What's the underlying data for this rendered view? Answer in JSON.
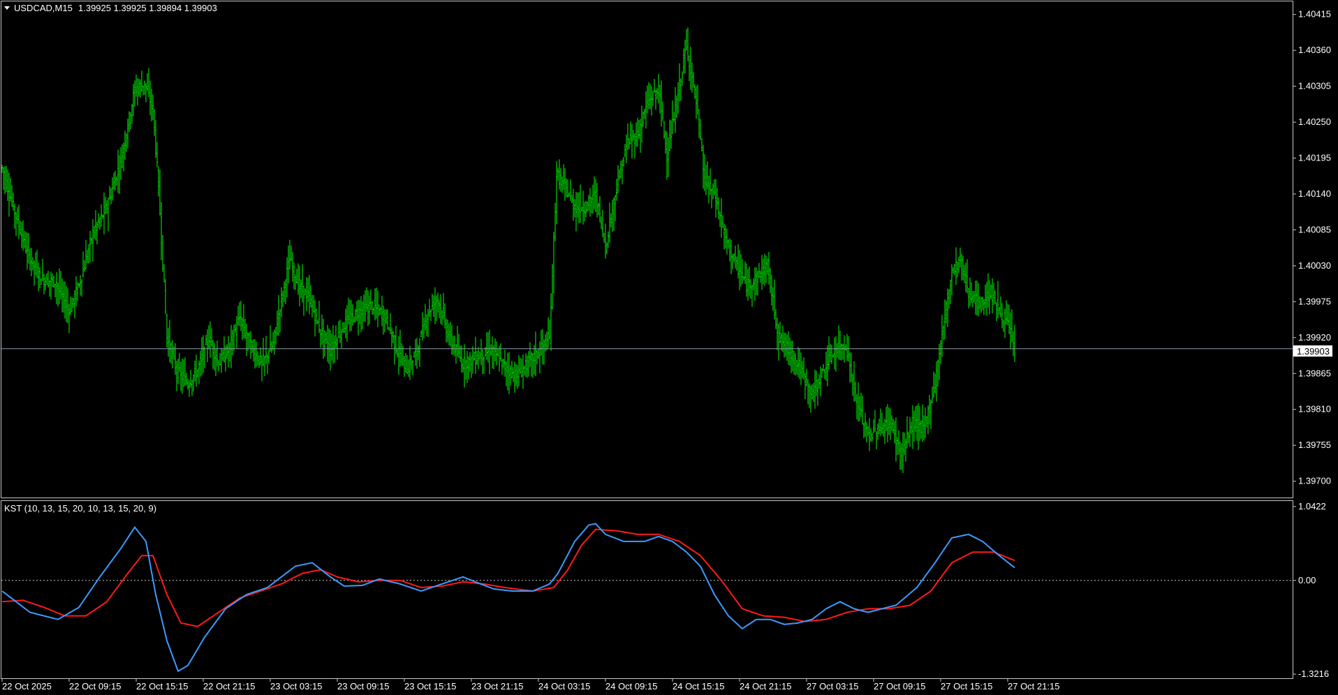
{
  "main_header": {
    "symbol": "USDCAD,M15",
    "ohlc": "1.39925 1.39925 1.39894 1.39903"
  },
  "indicator_header": "KST (10, 13, 15, 20, 10, 13, 15, 20, 9)",
  "current_price_label": "1.39903",
  "colors": {
    "background": "#000000",
    "bars": "#00ff00",
    "frame": "#c8c8c8",
    "price_line": "#8a9aa8",
    "kst_line": "#3a9bff",
    "signal_line": "#ff1a1a",
    "zero_line": "#c8c8c8",
    "text": "#ffffff"
  },
  "price_axis": {
    "ticks": [
      "1.40415",
      "1.40360",
      "1.40305",
      "1.40250",
      "1.40195",
      "1.40140",
      "1.40085",
      "1.40030",
      "1.39975",
      "1.39920",
      "1.39865",
      "1.39810",
      "1.39755",
      "1.39700"
    ],
    "min": 1.39675,
    "max": 1.40435
  },
  "indicator_axis": {
    "ticks": [
      "1.0422",
      "0.00",
      "-1.3216"
    ],
    "min": -1.38,
    "max": 1.12
  },
  "time_axis": {
    "labels": [
      "22 Oct 2025",
      "22 Oct 09:15",
      "22 Oct 15:15",
      "22 Oct 21:15",
      "23 Oct 03:15",
      "23 Oct 09:15",
      "23 Oct 15:15",
      "23 Oct 21:15",
      "24 Oct 03:15",
      "24 Oct 09:15",
      "24 Oct 15:15",
      "24 Oct 21:15",
      "27 Oct 03:15",
      "27 Oct 09:15",
      "27 Oct 15:15",
      "27 Oct 21:15"
    ]
  },
  "chart_data": {
    "type": "line",
    "description_units": "price path for OHLC bars (USDCAD M15) and KST indicator values",
    "price_path": [
      [
        0,
        1.4018
      ],
      [
        8,
        1.4012
      ],
      [
        18,
        1.4005
      ],
      [
        28,
        1.4001
      ],
      [
        38,
        1.40005
      ],
      [
        48,
        1.3996
      ],
      [
        55,
        1.4
      ],
      [
        65,
        1.4008
      ],
      [
        75,
        1.4012
      ],
      [
        85,
        1.4019
      ],
      [
        95,
        1.403
      ],
      [
        102,
        1.4031
      ],
      [
        108,
        1.4027
      ],
      [
        112,
        1.4015
      ],
      [
        118,
        1.3992
      ],
      [
        125,
        1.3987
      ],
      [
        133,
        1.3985
      ],
      [
        140,
        1.3987
      ],
      [
        148,
        1.3992
      ],
      [
        155,
        1.3988
      ],
      [
        162,
        1.399
      ],
      [
        170,
        1.3995
      ],
      [
        178,
        1.39905
      ],
      [
        186,
        1.3988
      ],
      [
        194,
        1.3991
      ],
      [
        200,
        1.3998
      ],
      [
        206,
        1.4004
      ],
      [
        212,
        1.4
      ],
      [
        220,
        1.3998
      ],
      [
        228,
        1.3993
      ],
      [
        235,
        1.399
      ],
      [
        245,
        1.3994
      ],
      [
        255,
        1.3996
      ],
      [
        265,
        1.3997
      ],
      [
        275,
        1.3995
      ],
      [
        283,
        1.399
      ],
      [
        290,
        1.3987
      ],
      [
        297,
        1.399
      ],
      [
        305,
        1.3996
      ],
      [
        312,
        1.3998
      ],
      [
        320,
        1.3992
      ],
      [
        330,
        1.3988
      ],
      [
        340,
        1.3989
      ],
      [
        350,
        1.399
      ],
      [
        360,
        1.39875
      ],
      [
        368,
        1.3986
      ],
      [
        376,
        1.3988
      ],
      [
        385,
        1.399
      ],
      [
        392,
        1.3992
      ],
      [
        397,
        1.4017
      ],
      [
        403,
        1.4015
      ],
      [
        410,
        1.4012
      ],
      [
        418,
        1.4012
      ],
      [
        425,
        1.4014
      ],
      [
        432,
        1.4006
      ],
      [
        440,
        1.4015
      ],
      [
        448,
        1.4022
      ],
      [
        455,
        1.4023
      ],
      [
        462,
        1.4028
      ],
      [
        470,
        1.403
      ],
      [
        476,
        1.402
      ],
      [
        483,
        1.4028
      ],
      [
        490,
        1.4037
      ],
      [
        497,
        1.4028
      ],
      [
        503,
        1.4016
      ],
      [
        510,
        1.4014
      ],
      [
        518,
        1.4007
      ],
      [
        526,
        1.4003
      ],
      [
        533,
        1.4
      ],
      [
        540,
        1.4001
      ],
      [
        548,
        1.4003
      ],
      [
        556,
        1.3992
      ],
      [
        564,
        1.399
      ],
      [
        572,
        1.3987
      ],
      [
        580,
        1.3983
      ],
      [
        588,
        1.3987
      ],
      [
        596,
        1.399
      ],
      [
        604,
        1.3991
      ],
      [
        612,
        1.3982
      ],
      [
        620,
        1.3977
      ],
      [
        628,
        1.3978
      ],
      [
        636,
        1.3979
      ],
      [
        644,
        1.3974
      ],
      [
        652,
        1.3979
      ],
      [
        660,
        1.3978
      ],
      [
        668,
        1.3985
      ],
      [
        674,
        1.3994
      ],
      [
        680,
        1.4002
      ],
      [
        686,
        1.4004
      ],
      [
        692,
        1.3999
      ],
      [
        700,
        1.3997
      ],
      [
        708,
        1.3999
      ],
      [
        714,
        1.3996
      ],
      [
        720,
        1.3994
      ],
      [
        725,
        1.39903
      ]
    ],
    "kst_path": [
      [
        0,
        -0.15
      ],
      [
        20,
        -0.45
      ],
      [
        40,
        -0.55
      ],
      [
        55,
        -0.38
      ],
      [
        70,
        0.05
      ],
      [
        85,
        0.45
      ],
      [
        95,
        0.75
      ],
      [
        103,
        0.55
      ],
      [
        110,
        -0.2
      ],
      [
        118,
        -0.85
      ],
      [
        126,
        -1.28
      ],
      [
        133,
        -1.2
      ],
      [
        145,
        -0.8
      ],
      [
        160,
        -0.4
      ],
      [
        175,
        -0.2
      ],
      [
        190,
        -0.1
      ],
      [
        200,
        0.05
      ],
      [
        210,
        0.2
      ],
      [
        222,
        0.25
      ],
      [
        235,
        0.05
      ],
      [
        245,
        -0.08
      ],
      [
        258,
        -0.07
      ],
      [
        270,
        0.02
      ],
      [
        285,
        -0.05
      ],
      [
        300,
        -0.15
      ],
      [
        315,
        -0.05
      ],
      [
        330,
        0.05
      ],
      [
        340,
        -0.03
      ],
      [
        352,
        -0.12
      ],
      [
        365,
        -0.15
      ],
      [
        380,
        -0.15
      ],
      [
        392,
        -0.05
      ],
      [
        398,
        0.1
      ],
      [
        410,
        0.55
      ],
      [
        420,
        0.78
      ],
      [
        425,
        0.8
      ],
      [
        432,
        0.65
      ],
      [
        445,
        0.55
      ],
      [
        460,
        0.55
      ],
      [
        470,
        0.62
      ],
      [
        480,
        0.55
      ],
      [
        490,
        0.4
      ],
      [
        500,
        0.2
      ],
      [
        510,
        -0.2
      ],
      [
        520,
        -0.5
      ],
      [
        530,
        -0.68
      ],
      [
        540,
        -0.55
      ],
      [
        550,
        -0.55
      ],
      [
        560,
        -0.62
      ],
      [
        570,
        -0.6
      ],
      [
        580,
        -0.55
      ],
      [
        590,
        -0.4
      ],
      [
        600,
        -0.3
      ],
      [
        610,
        -0.4
      ],
      [
        620,
        -0.45
      ],
      [
        630,
        -0.4
      ],
      [
        640,
        -0.35
      ],
      [
        655,
        -0.1
      ],
      [
        668,
        0.25
      ],
      [
        680,
        0.6
      ],
      [
        692,
        0.65
      ],
      [
        702,
        0.55
      ],
      [
        714,
        0.35
      ],
      [
        725,
        0.18
      ]
    ],
    "signal_path": [
      [
        0,
        -0.3
      ],
      [
        15,
        -0.28
      ],
      [
        30,
        -0.38
      ],
      [
        45,
        -0.5
      ],
      [
        60,
        -0.5
      ],
      [
        75,
        -0.3
      ],
      [
        90,
        0.1
      ],
      [
        100,
        0.35
      ],
      [
        108,
        0.35
      ],
      [
        118,
        -0.2
      ],
      [
        128,
        -0.6
      ],
      [
        140,
        -0.65
      ],
      [
        155,
        -0.45
      ],
      [
        170,
        -0.25
      ],
      [
        185,
        -0.15
      ],
      [
        200,
        -0.05
      ],
      [
        215,
        0.1
      ],
      [
        228,
        0.15
      ],
      [
        240,
        0.05
      ],
      [
        255,
        -0.02
      ],
      [
        270,
        0.0
      ],
      [
        285,
        0.0
      ],
      [
        300,
        -0.1
      ],
      [
        315,
        -0.08
      ],
      [
        330,
        -0.02
      ],
      [
        345,
        -0.05
      ],
      [
        360,
        -0.1
      ],
      [
        380,
        -0.15
      ],
      [
        395,
        -0.1
      ],
      [
        405,
        0.15
      ],
      [
        415,
        0.5
      ],
      [
        425,
        0.72
      ],
      [
        440,
        0.7
      ],
      [
        455,
        0.65
      ],
      [
        470,
        0.65
      ],
      [
        485,
        0.55
      ],
      [
        500,
        0.35
      ],
      [
        515,
        0.0
      ],
      [
        530,
        -0.4
      ],
      [
        545,
        -0.5
      ],
      [
        560,
        -0.52
      ],
      [
        575,
        -0.58
      ],
      [
        590,
        -0.55
      ],
      [
        605,
        -0.45
      ],
      [
        620,
        -0.4
      ],
      [
        635,
        -0.4
      ],
      [
        650,
        -0.35
      ],
      [
        665,
        -0.15
      ],
      [
        680,
        0.25
      ],
      [
        695,
        0.4
      ],
      [
        710,
        0.4
      ],
      [
        725,
        0.28
      ]
    ]
  }
}
